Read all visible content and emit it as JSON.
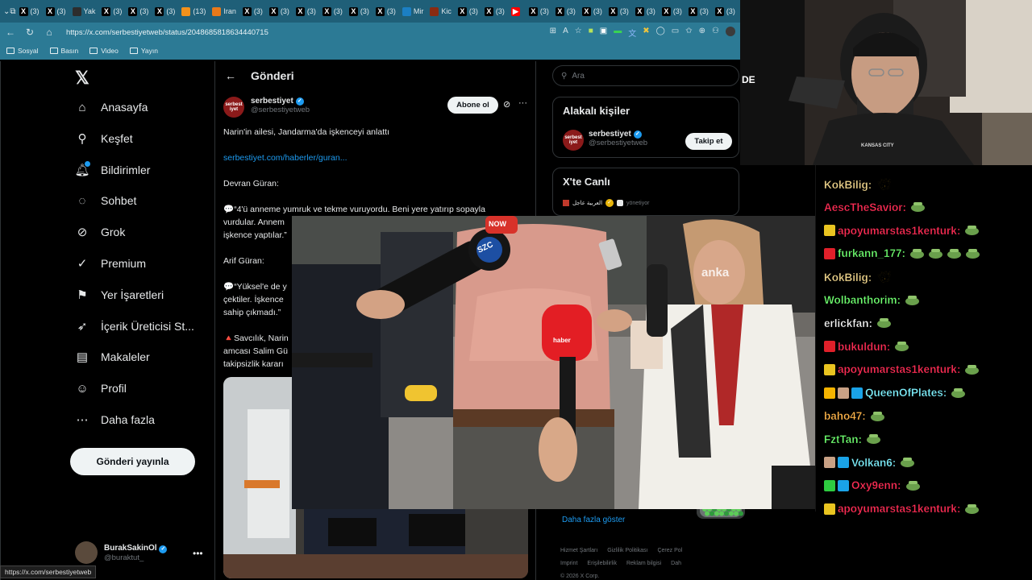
{
  "browser": {
    "tabs": [
      {
        "label": "(3)",
        "icon": "x",
        "color": "#000000"
      },
      {
        "label": "(3)",
        "icon": "x",
        "color": "#000000"
      },
      {
        "label": "Yak",
        "icon": "app",
        "color": "#2d2d2d"
      },
      {
        "label": "(3)",
        "icon": "x",
        "color": "#000000"
      },
      {
        "label": "(3)",
        "icon": "x",
        "color": "#000000"
      },
      {
        "label": "(3)",
        "icon": "x",
        "color": "#000000"
      },
      {
        "label": "(13)",
        "icon": "news",
        "color": "#f2911b"
      },
      {
        "label": "Iran",
        "icon": "news",
        "color": "#e8791a"
      },
      {
        "label": "(3)",
        "icon": "x",
        "color": "#000000"
      },
      {
        "label": "(3)",
        "icon": "x",
        "color": "#000000"
      },
      {
        "label": "(3)",
        "icon": "x",
        "color": "#000000"
      },
      {
        "label": "(3)",
        "icon": "x",
        "color": "#000000"
      },
      {
        "label": "(3)",
        "icon": "x",
        "color": "#000000"
      },
      {
        "label": "(3)",
        "icon": "x",
        "color": "#000000"
      },
      {
        "label": "Mir",
        "icon": "news",
        "color": "#1b7fc4"
      },
      {
        "label": "Kic",
        "icon": "news",
        "color": "#8a2b12"
      },
      {
        "label": "(3)",
        "icon": "x",
        "color": "#000000"
      },
      {
        "label": "(3)",
        "icon": "x",
        "color": "#000000"
      },
      {
        "label": "",
        "icon": "youtube",
        "color": "#ff0000"
      },
      {
        "label": "(3)",
        "icon": "x",
        "color": "#000000"
      },
      {
        "label": "(3)",
        "icon": "x",
        "color": "#000000"
      },
      {
        "label": "(3)",
        "icon": "x",
        "color": "#000000"
      },
      {
        "label": "(3)",
        "icon": "x",
        "color": "#000000"
      },
      {
        "label": "(3)",
        "icon": "x",
        "color": "#000000"
      },
      {
        "label": "(3)",
        "icon": "x",
        "color": "#000000"
      },
      {
        "label": "(3)",
        "icon": "x",
        "color": "#000000"
      },
      {
        "label": "(3)",
        "icon": "x",
        "color": "#000000"
      }
    ],
    "active_tab_close": "✕",
    "new_tab": "+",
    "url": "https://x.com/serbestiyetweb/status/2048685818634440715",
    "bookmarks": [
      "Sosyal",
      "Basın",
      "Video",
      "Yayın"
    ],
    "status_bar_url": "https://x.com/serbestiyetweb"
  },
  "nav": {
    "items": [
      {
        "label": "Anasayfa",
        "icon": "home-icon"
      },
      {
        "label": "Keşfet",
        "icon": "search-icon"
      },
      {
        "label": "Bildirimler",
        "icon": "bell-icon"
      },
      {
        "label": "Sohbet",
        "icon": "chat-icon"
      },
      {
        "label": "Grok",
        "icon": "grok-icon"
      },
      {
        "label": "Premium",
        "icon": "premium-icon"
      },
      {
        "label": "Yer İşaretleri",
        "icon": "bookmark-icon"
      },
      {
        "label": "İçerik Üreticisi St...",
        "icon": "rocket-icon"
      },
      {
        "label": "Makaleler",
        "icon": "article-icon"
      },
      {
        "label": "Profil",
        "icon": "profile-icon"
      },
      {
        "label": "Daha fazla",
        "icon": "more-icon"
      }
    ],
    "post_button": "Gönderi yayınla",
    "account": {
      "name": "BurakSakinOl",
      "handle": "@buraktut_"
    }
  },
  "post": {
    "header_title": "Gönderi",
    "author_name": "serbestiyet",
    "author_handle": "@serbestiyetweb",
    "subscribe_label": "Abone ol",
    "headline": "Narin'in ailesi, Jandarma'da işkenceyi anlattı",
    "link": "serbestiyet.com/haberler/guran...",
    "speaker1": "Devran Güran:",
    "quote1_lines": [
      "💬“4'ü anneme yumruk ve tekme vuruyordu. Beni yere yatırıp sopayla",
      "vurdular. Annem",
      "işkence yaptılar.”"
    ],
    "speaker2": "Arif Güran:",
    "quote2_lines": [
      "💬“Yüksel'e de y",
      "çektiler. İşkence",
      "sahip çıkmadı.”"
    ],
    "note_lines": [
      "🔺Savcılık, Narin",
      "amcası Salim Gü",
      "takipsizlik kararı"
    ]
  },
  "right": {
    "search_placeholder": "Ara",
    "related_title": "Alakalı kişiler",
    "related_name": "serbestiyet",
    "related_handle": "@serbestiyetweb",
    "follow_label": "Takip et",
    "live_title": "X'te Canlı",
    "live_channel": "العربية عاجل",
    "live_status": "yönetiyor",
    "show_more": "Daha fazla göster",
    "footer_lines": [
      [
        "Hizmet Şartları",
        "Gizlilik Politikası",
        "Çerez Pol"
      ],
      [
        "Imprint",
        "Erişilebilirlik",
        "Reklam bilgisi",
        "Dah"
      ],
      [
        "© 2026 X Corp."
      ]
    ]
  },
  "overlay": {
    "watermark": "anka",
    "mic_labels": [
      "SZC",
      "NOW",
      "haber"
    ]
  },
  "chat": {
    "messages": [
      {
        "user": "KokBilig:",
        "color": "#f0d58c",
        "badges": [],
        "emotes": [
          "gold"
        ]
      },
      {
        "user": "AescTheSavior:",
        "color": "#ff2d55",
        "badges": [],
        "emotes": [
          "frog"
        ]
      },
      {
        "user": "apoyumarstas1kenturk:",
        "color": "#ff2d55",
        "badges": [
          "#e9c420"
        ],
        "emotes": [
          "frog"
        ]
      },
      {
        "user": "furkann_177:",
        "color": "#6fff6f",
        "badges": [
          "#e0202a"
        ],
        "emotes": [
          "frog",
          "frog",
          "frog",
          "frog"
        ]
      },
      {
        "user": "KokBilig:",
        "color": "#f0d58c",
        "badges": [],
        "emotes": [
          "gold"
        ]
      },
      {
        "user": "Wolbanthorim:",
        "color": "#6fff6f",
        "badges": [],
        "emotes": [
          "frog"
        ]
      },
      {
        "user": "erlickfan:",
        "color": "#f5f5f5",
        "badges": [],
        "emotes": [
          "frog"
        ]
      },
      {
        "user": "bukuldun:",
        "color": "#ff2d55",
        "badges": [
          "#e0202a"
        ],
        "emotes": [
          "frog"
        ]
      },
      {
        "user": "apoyumarstas1kenturk:",
        "color": "#ff2d55",
        "badges": [
          "#e9c420"
        ],
        "emotes": [
          "frog"
        ]
      },
      {
        "user": "QueenOfPlates:",
        "color": "#7ff2ff",
        "badges": [
          "#f5b400",
          "#c9a185",
          "#1aa3e8"
        ],
        "emotes": [
          "frog"
        ]
      },
      {
        "user": "baho47:",
        "color": "#ffb54a",
        "badges": [],
        "emotes": [
          "frog"
        ]
      },
      {
        "user": "FztTan:",
        "color": "#6fff6f",
        "badges": [],
        "emotes": [
          "frog"
        ]
      },
      {
        "user": "Volkan6:",
        "color": "#7ff2ff",
        "badges": [
          "#c9a185",
          "#1aa3e8"
        ],
        "emotes": [
          "frog"
        ]
      },
      {
        "user": "Oxy9enn:",
        "color": "#ff2d55",
        "badges": [
          "#2ecc40",
          "#1aa3e8"
        ],
        "emotes": [
          "frog"
        ]
      },
      {
        "user": "apoyumarstas1kenturk:",
        "color": "#ff2d55",
        "badges": [
          "#e9c420"
        ],
        "emotes": [
          "frog"
        ]
      }
    ]
  },
  "webcam": {
    "overlay_text": "DE",
    "shirt_text": "KANSAS CITY"
  },
  "colors": {
    "accent": "#1d9bf0",
    "browser": "#2c7a95",
    "tabbar": "#1f5f78"
  }
}
